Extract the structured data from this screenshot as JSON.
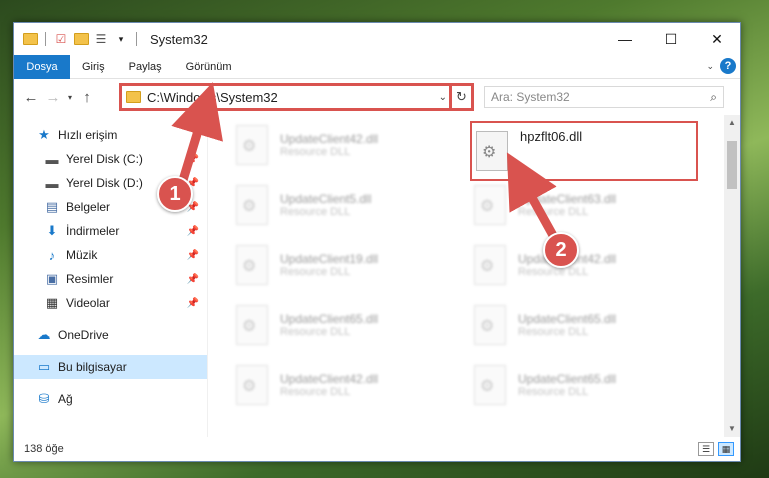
{
  "window": {
    "title": "System32",
    "controls": {
      "minimize": "—",
      "maximize": "☐",
      "close": "✕"
    }
  },
  "ribbon": {
    "tabs": [
      "Dosya",
      "Giriş",
      "Paylaş",
      "Görünüm"
    ],
    "help": "?"
  },
  "nav": {
    "back": "←",
    "forward": "→",
    "up": "↑",
    "address": "C:\\Windows\\System32",
    "search_placeholder": "Ara: System32"
  },
  "sidebar": {
    "quick_access": "Hızlı erişim",
    "items": [
      {
        "label": "Yerel Disk (C:)",
        "icon": "drive-icon",
        "pinned": true
      },
      {
        "label": "Yerel Disk (D:)",
        "icon": "drive-icon",
        "pinned": true
      },
      {
        "label": "Belgeler",
        "icon": "documents-icon",
        "pinned": true
      },
      {
        "label": "İndirmeler",
        "icon": "download-icon",
        "pinned": true
      },
      {
        "label": "Müzik",
        "icon": "music-icon",
        "pinned": true
      },
      {
        "label": "Resimler",
        "icon": "pictures-icon",
        "pinned": true
      },
      {
        "label": "Videolar",
        "icon": "videos-icon",
        "pinned": true
      }
    ],
    "onedrive": "OneDrive",
    "this_pc": "Bu bilgisayar",
    "network": "Ağ"
  },
  "files": {
    "left_column": [
      {
        "name": "UpdateClient42.dll",
        "type": "Resource DLL"
      },
      {
        "name": "UpdateClient5.dll",
        "type": "Resource DLL"
      },
      {
        "name": "UpdateClient19.dll",
        "type": "Resource DLL"
      },
      {
        "name": "UpdateClient65.dll",
        "type": "Resource DLL"
      },
      {
        "name": "UpdateClient42.dll",
        "type": "Resource DLL"
      }
    ],
    "right_column": [
      {
        "name": "hpzflt06.dll",
        "type": "",
        "highlighted": true
      },
      {
        "name": "UpdateClient63.dll",
        "type": "Resource DLL"
      },
      {
        "name": "UpdateClient42.dll",
        "type": "Resource DLL"
      },
      {
        "name": "UpdateClient65.dll",
        "type": "Resource DLL"
      },
      {
        "name": "UpdateClient65.dll",
        "type": "Resource DLL"
      }
    ]
  },
  "status": {
    "count": "138 öğe"
  },
  "annotations": {
    "step1": "1",
    "step2": "2",
    "color": "#d9534f"
  }
}
